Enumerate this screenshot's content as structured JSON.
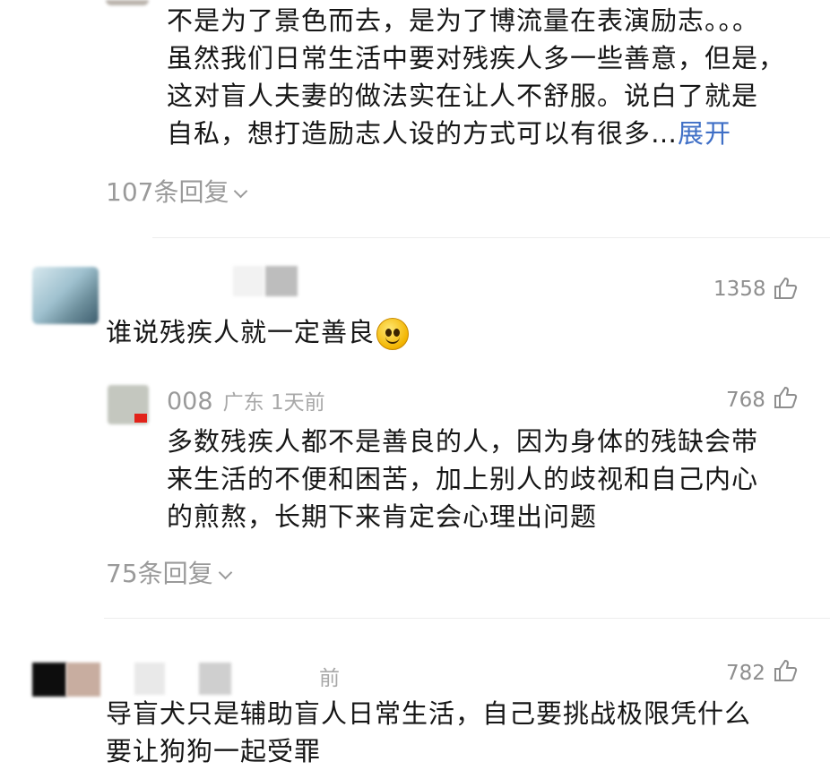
{
  "comment1": {
    "lines": [
      "不是为了景色而去，是为了博流量在表演励志。。。",
      "虽然我们日常生活中要对残疾人多一些善意，但是，",
      "这对盲人夫妻的做法实在让人不舒服。说白了就是",
      "自私，想打造励志人设的方式可以有很多…"
    ],
    "expand": "展开",
    "replies": "107条回复"
  },
  "comment2": {
    "likes": "1358",
    "text": "谁说残疾人就一定善良"
  },
  "reply1": {
    "username": "008",
    "location_time": "广东 1天前",
    "likes": "768",
    "lines": [
      "多数残疾人都不是善良的人，因为身体的残缺会带",
      "来生活的不便和困苦，加上别人的歧视和自己内心",
      "的煎熬，长期下来肯定会心理出问题"
    ],
    "replies": "75条回复"
  },
  "comment3": {
    "time_partial": "前",
    "likes": "782",
    "lines": [
      "导盲犬只是辅助盲人日常生活，自己要挑战极限凭什么",
      "要让狗狗一起受罪"
    ]
  },
  "colors": {
    "text": "#161616",
    "meta": "#9a9a9a",
    "link": "#3f6fc6",
    "divider": "#ececec"
  }
}
